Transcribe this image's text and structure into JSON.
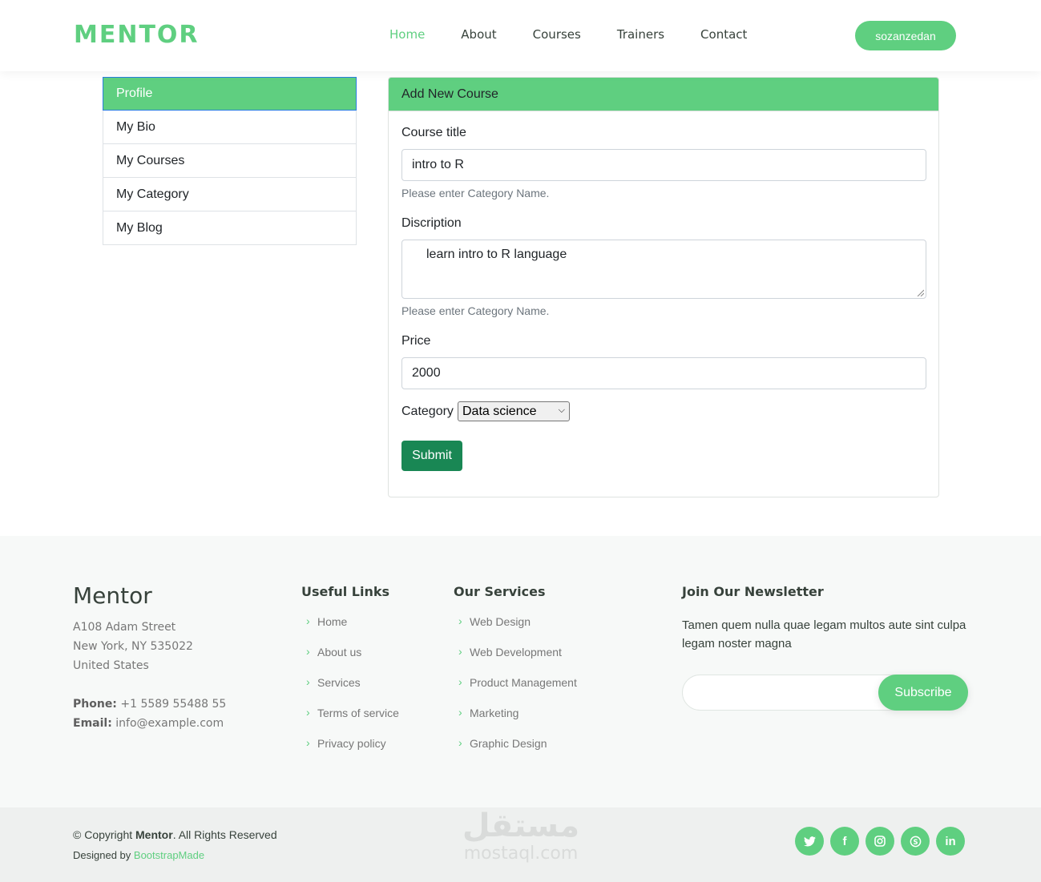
{
  "header": {
    "logo": "MENTOR",
    "nav": [
      "Home",
      "About",
      "Courses",
      "Trainers",
      "Contact"
    ],
    "user": "sozanzedan"
  },
  "sidebar": {
    "items": [
      "Profile",
      "My Bio",
      "My Courses",
      "My Category",
      "My Blog"
    ]
  },
  "form": {
    "header": "Add New Course",
    "title_label": "Course title",
    "title_value": "intro to R",
    "title_help": "Please enter Category Name.",
    "desc_label": "Discription",
    "desc_value": "learn intro to R language",
    "desc_help": "Please enter Category Name.",
    "price_label": "Price",
    "price_value": "2000",
    "category_label": "Category",
    "category_value": "Data science",
    "submit": "Submit"
  },
  "footer": {
    "brand": "Mentor",
    "address": [
      "A108 Adam Street",
      "New York, NY 535022",
      "United States"
    ],
    "phone_label": "Phone:",
    "phone": "+1 5589 55488 55",
    "email_label": "Email:",
    "email": "info@example.com",
    "useful_title": "Useful Links",
    "useful_links": [
      "Home",
      "About us",
      "Services",
      "Terms of service",
      "Privacy policy"
    ],
    "services_title": "Our Services",
    "services": [
      "Web Design",
      "Web Development",
      "Product Management",
      "Marketing",
      "Graphic Design"
    ],
    "newsletter_title": "Join Our Newsletter",
    "newsletter_text": "Tamen quem nulla quae legam multos aute sint culpa legam noster magna",
    "subscribe": "Subscribe"
  },
  "bottom": {
    "copyright_prefix": "© Copyright",
    "copyright_brand": "Mentor",
    "copyright_suffix": ". All Rights Reserved",
    "designed_prefix": "Designed by",
    "designed_link": "BootstrapMade",
    "watermark_ar": "مستقل",
    "watermark_en": "mostaql.com",
    "socials": [
      "twitter-icon",
      "facebook-icon",
      "instagram-icon",
      "skype-icon",
      "linkedin-icon"
    ]
  },
  "colors": {
    "accent": "#5fcf80",
    "submit": "#198754"
  }
}
